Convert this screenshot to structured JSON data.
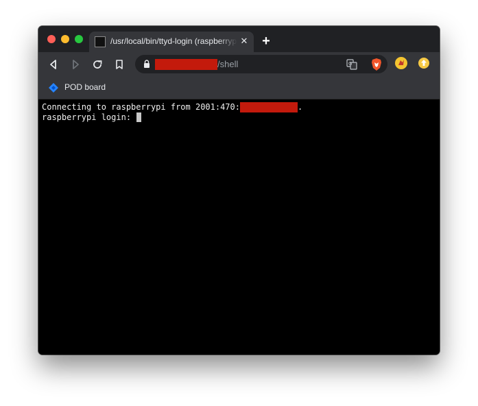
{
  "tab": {
    "title": "/usr/local/bin/ttyd-login (raspberrypi)",
    "close_glyph": "✕",
    "new_tab_glyph": "+"
  },
  "toolbar": {
    "back_icon": "back-arrow-icon",
    "forward_icon": "forward-arrow-icon",
    "reload_icon": "reload-icon",
    "bookmark_icon": "bookmark-icon"
  },
  "omnibox": {
    "url_suffix": "/shell",
    "url_redacted": true
  },
  "bookmarks": {
    "items": [
      {
        "label": "POD board",
        "icon": "jira-icon"
      }
    ]
  },
  "terminal": {
    "line1_prefix": "Connecting to raspberrypi from 2001:470:",
    "line1_suffix": ".",
    "line2": "raspberrypi login: "
  },
  "colors": {
    "redaction": "#c31a0c",
    "tab_active": "#35363a",
    "tabstrip": "#202124",
    "terminal_bg": "#000000"
  }
}
